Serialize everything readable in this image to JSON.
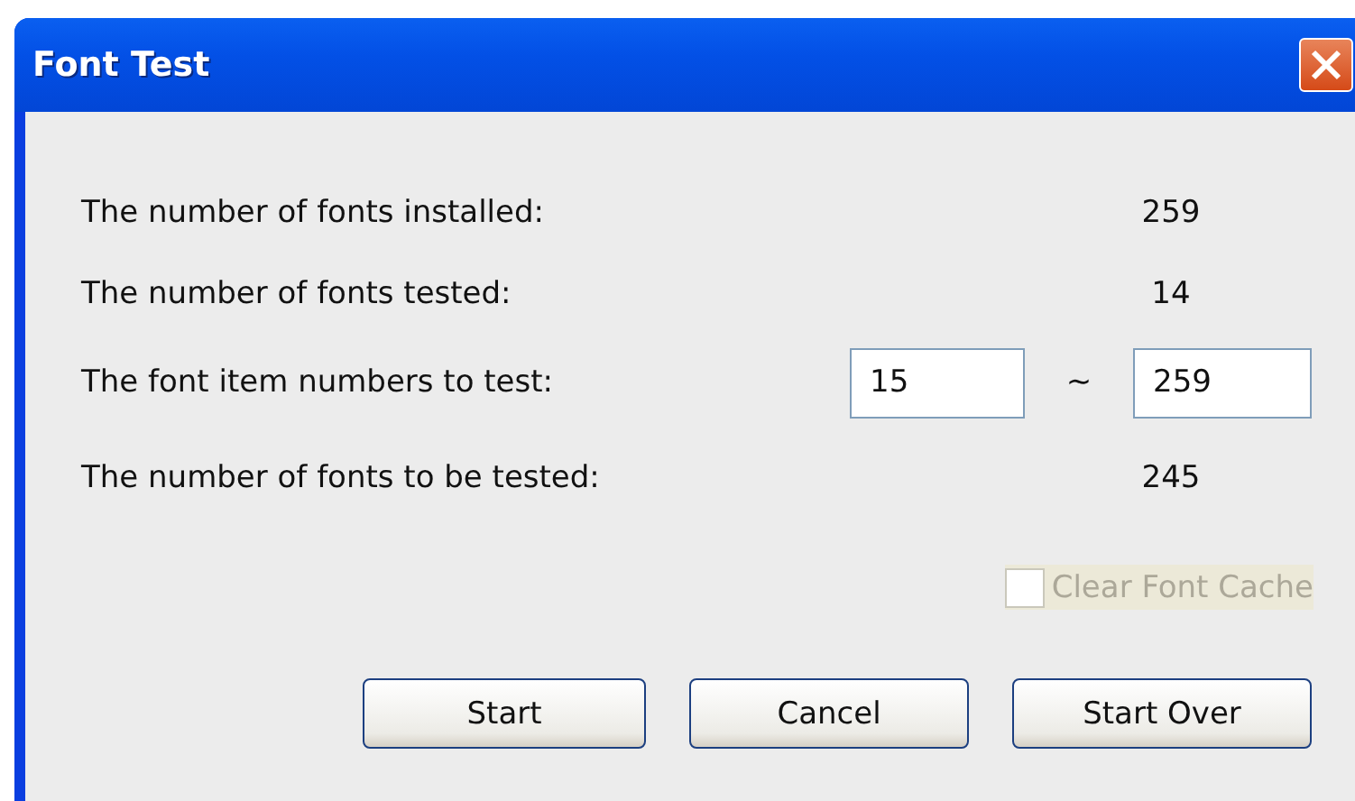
{
  "window": {
    "title": "Font Test"
  },
  "rows": [
    {
      "kind": "value",
      "label": "The number of fonts installed:",
      "value": "259"
    },
    {
      "kind": "value",
      "label": "The number of fonts tested:",
      "value": "14"
    },
    {
      "kind": "range",
      "label": "The font item numbers to test:",
      "from": "15",
      "separator": "~",
      "to": "259"
    },
    {
      "kind": "value",
      "label": "The number of fonts to be tested:",
      "value": "245"
    }
  ],
  "checkbox": {
    "label": "Clear Font Cache",
    "checked": false,
    "disabled": true
  },
  "buttons": [
    "Start",
    "Cancel",
    "Start Over"
  ]
}
